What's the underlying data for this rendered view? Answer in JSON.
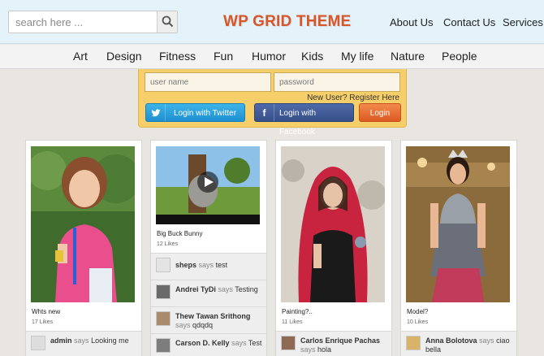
{
  "header": {
    "search_placeholder": "search here ...",
    "logo": "WP GRID THEME",
    "nav": [
      "About Us",
      "Contact Us",
      "Services"
    ]
  },
  "categories": [
    "Art",
    "Design",
    "Fitness",
    "Fun",
    "Humor",
    "Kids",
    "My life",
    "Nature",
    "People"
  ],
  "login": {
    "username_placeholder": "user name",
    "password_placeholder": "password",
    "new_user": "New User? Register Here",
    "twitter_label": "Login with Twitter",
    "facebook_label": "Login with Facebook",
    "login_label": "Login"
  },
  "says": "says",
  "posts": [
    {
      "title": "Whts new",
      "likes": "17 Likes",
      "comments": [
        {
          "user": "admin",
          "text": "Looking me"
        }
      ]
    },
    {
      "title": "Big Buck Bunny",
      "likes": "12 Likes",
      "comments": [
        {
          "user": "sheps",
          "text": "test"
        },
        {
          "user": "Andrei TyDi",
          "text": "Testing"
        },
        {
          "user": "Thew Tawan Srithong",
          "text": "qdqdq"
        },
        {
          "user": "Carson D. Kelly",
          "text": "Test"
        }
      ]
    },
    {
      "title": "Painting?..",
      "likes": "11 Likes",
      "comments": [
        {
          "user": "Carlos Enrique Pachas",
          "text": "hola"
        }
      ]
    },
    {
      "title": "Model?",
      "likes": "10 Likes",
      "comments": [
        {
          "user": "Anna Bolotova",
          "text": "ciao bella"
        }
      ]
    }
  ],
  "colors": {
    "logo": "#d9552a",
    "header_bg": "#e4f2f9",
    "login_bg": "#f6cf6a",
    "twitter": "#1f8fd0",
    "facebook": "#364f8a",
    "login_btn": "#dd5a22"
  }
}
